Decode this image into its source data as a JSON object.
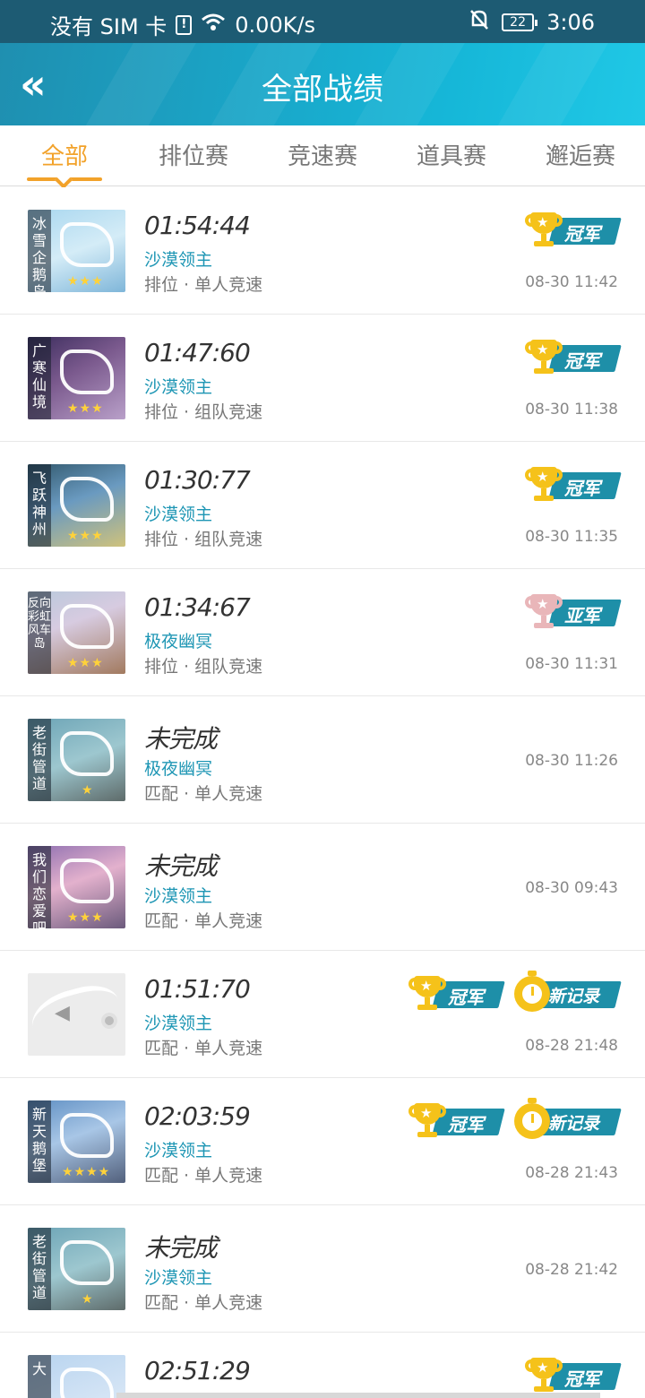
{
  "status_bar": {
    "carrier": "没有 SIM 卡",
    "sim_icon": "!",
    "speed": "0.00K/s",
    "battery": "22",
    "time": "3:06"
  },
  "header": {
    "back": "«",
    "title": "全部战绩"
  },
  "tabs": [
    "全部",
    "排位赛",
    "竞速赛",
    "道具赛",
    "邂逅赛"
  ],
  "badges": {
    "champion": "冠军",
    "runner_up": "亚军",
    "new_record": "新记录"
  },
  "records": [
    {
      "map": "冰雪企鹅岛",
      "time": "01:54:44",
      "kart": "沙漠领主",
      "mode": "排位 · 单人竞速",
      "date": "08-30 11:42",
      "stars": "★★★"
    },
    {
      "map": "广寒仙境",
      "time": "01:47:60",
      "kart": "沙漠领主",
      "mode": "排位 · 组队竞速",
      "date": "08-30 11:38",
      "stars": "★★★"
    },
    {
      "map": "飞跃神州",
      "time": "01:30:77",
      "kart": "沙漠领主",
      "mode": "排位 · 组队竞速",
      "date": "08-30 11:35",
      "stars": "★★★"
    },
    {
      "map": "反向彩虹风车岛",
      "time": "01:34:67",
      "kart": "极夜幽冥",
      "mode": "排位 · 组队竞速",
      "date": "08-30 11:31",
      "stars": "★★★"
    },
    {
      "map": "老街管道",
      "time": "未完成",
      "kart": "极夜幽冥",
      "mode": "匹配 · 单人竞速",
      "date": "08-30 11:26",
      "stars": "★"
    },
    {
      "map": "我们恋爱吧",
      "time": "未完成",
      "kart": "沙漠领主",
      "mode": "匹配 · 单人竞速",
      "date": "08-30 09:43",
      "stars": "★★★"
    },
    {
      "map": "",
      "time": "01:51:70",
      "kart": "沙漠领主",
      "mode": "匹配 · 单人竞速",
      "date": "08-28 21:48",
      "stars": ""
    },
    {
      "map": "新天鹅堡",
      "time": "02:03:59",
      "kart": "沙漠领主",
      "mode": "匹配 · 单人竞速",
      "date": "08-28 21:43",
      "stars": "★★★★"
    },
    {
      "map": "老街管道",
      "time": "未完成",
      "kart": "沙漠领主",
      "mode": "匹配 · 单人竞速",
      "date": "08-28 21:42",
      "stars": "★"
    },
    {
      "map": "大",
      "time": "02:51:29",
      "kart": "",
      "mode": "",
      "date": "",
      "stars": ""
    }
  ],
  "colors": {
    "accent": "#f2a22a",
    "header": "#1aa6c8",
    "kart_text": "#1e96b4",
    "banner": "#1e8fa8",
    "gold": "#f5c21a",
    "silver": "#e9b6b9"
  }
}
